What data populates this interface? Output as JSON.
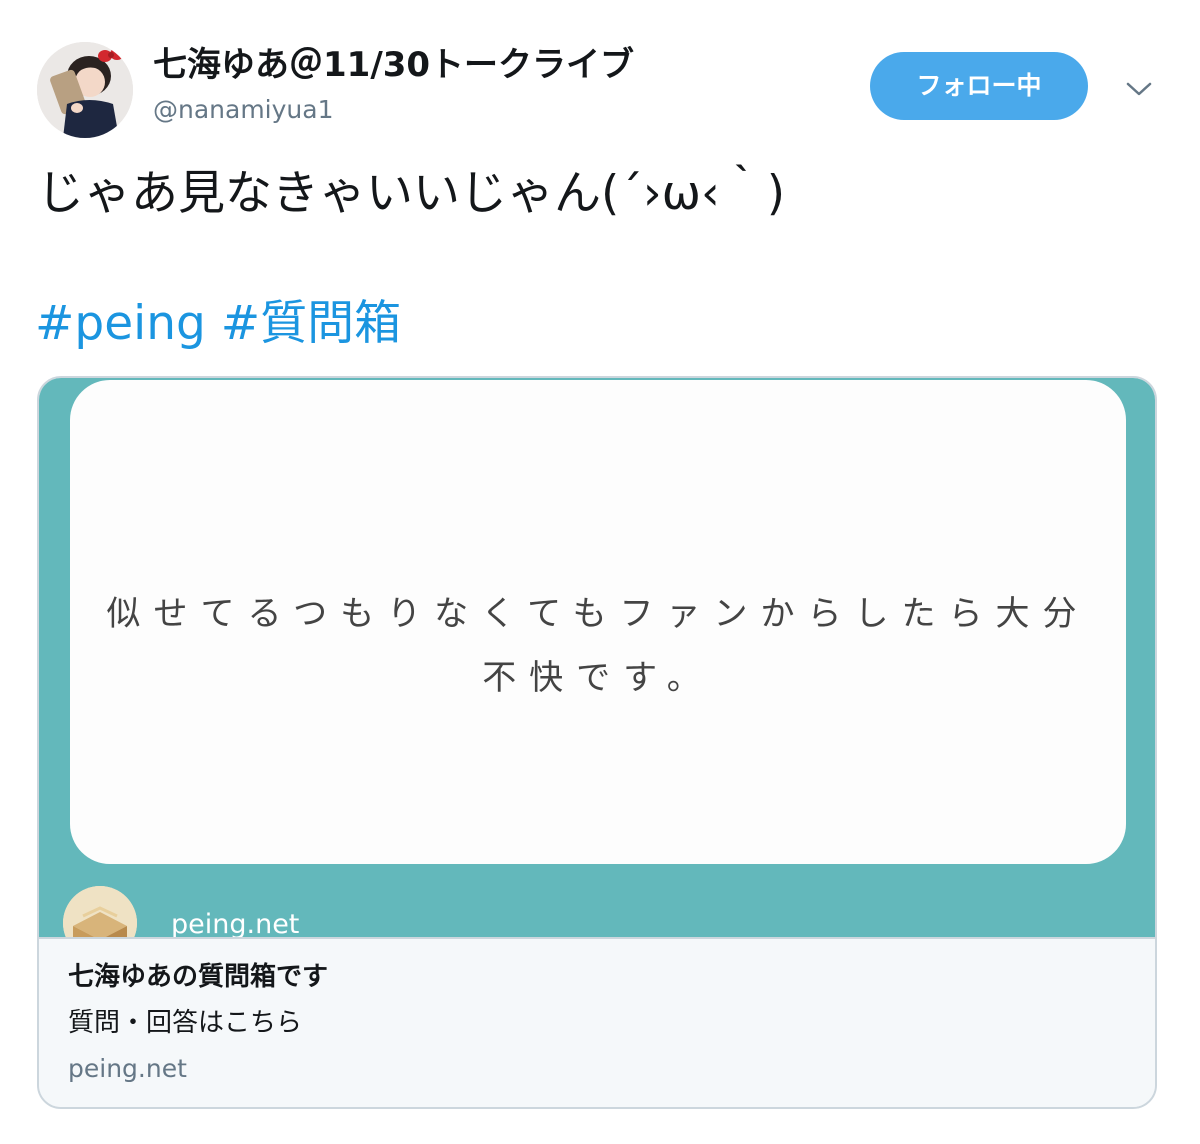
{
  "user": {
    "display_name": "七海ゆあ＠11/30トークライブ",
    "handle": "@nanamiyua1"
  },
  "actions": {
    "follow_label": "フォロー中",
    "menu_icon": "chevron-down-icon"
  },
  "tweet": {
    "text": "じゃあ見なきゃいいじゃん(´›ω‹｀)",
    "hashtags": [
      "#peing",
      "#質問箱"
    ]
  },
  "card": {
    "image": {
      "question_line1": "似せてるつもりなくてもファンからしたら大分",
      "question_line2": "不快です。",
      "domain": "peing.net",
      "background_color": "#63b8bb"
    },
    "title": "七海ゆあの質問箱です",
    "description": "質問・回答はこちら",
    "domain": "peing.net"
  },
  "colors": {
    "accent": "#1b95e0",
    "follow_button": "#4aa9eb",
    "secondary_text": "#657786",
    "border": "#ccd6dd"
  }
}
